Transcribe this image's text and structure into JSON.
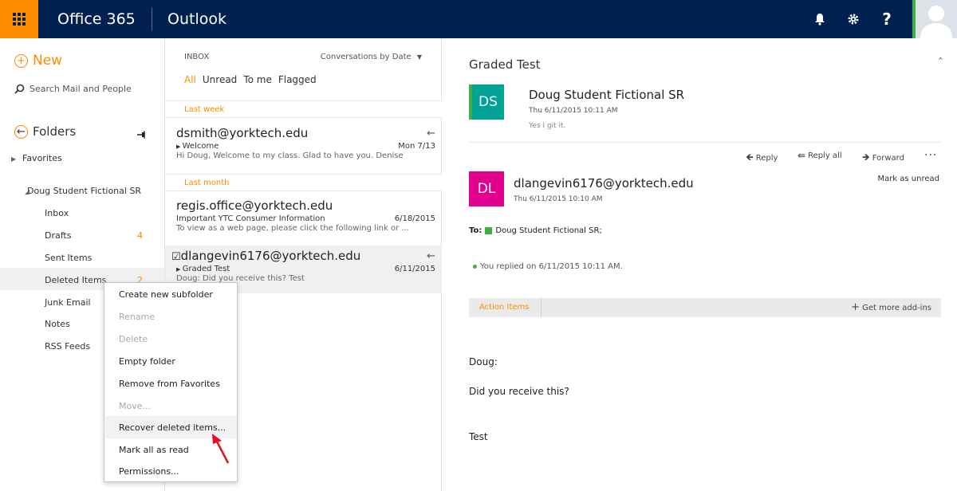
{
  "header": {
    "brand": "Office 365",
    "app": "Outlook",
    "help_label": "?"
  },
  "leftnav": {
    "new_label": "New",
    "search_placeholder": "Search Mail and People",
    "folders_label": "Folders",
    "favorites_label": "Favorites",
    "account_label": "Doug Student Fictional SR",
    "folders": [
      {
        "label": "Inbox",
        "count": ""
      },
      {
        "label": "Drafts",
        "count": "4"
      },
      {
        "label": "Sent Items",
        "count": ""
      },
      {
        "label": "Deleted Items",
        "count": "2"
      },
      {
        "label": "Junk Email",
        "count": ""
      },
      {
        "label": "Notes",
        "count": ""
      },
      {
        "label": "RSS Feeds",
        "count": ""
      }
    ]
  },
  "messagelist": {
    "folder_label": "INBOX",
    "sort_label": "Conversations by Date",
    "filters": [
      "All",
      "Unread",
      "To me",
      "Flagged"
    ],
    "groups": [
      "Last week",
      "Last month"
    ],
    "messages": [
      {
        "from": "dsmith@yorktech.edu",
        "subject": "Welcome",
        "preview": "Hi Doug,  Welcome to my class. Glad to have you.  Denise",
        "date": "Mon 7/13"
      },
      {
        "from": "regis.office@yorktech.edu",
        "subject": "Important YTC Consumer Information",
        "preview": "To view as a web page, please click the following link or ...",
        "date": "6/18/2015"
      },
      {
        "from": "dlangevin6176@yorktech.edu",
        "subject": "Graded Test",
        "preview": "Doug:  Did you receive this?  Test",
        "date": "6/11/2015"
      }
    ]
  },
  "reading": {
    "title": "Graded Test",
    "first": {
      "initials": "DS",
      "sender": "Doug Student Fictional SR",
      "date": "Thu 6/11/2015 10:11 AM",
      "preview": "Yes I git it."
    },
    "actions": {
      "reply": "Reply",
      "reply_all": "Reply all",
      "forward": "Forward",
      "more": "..."
    },
    "second": {
      "initials": "DL",
      "sender": "dlangevin6176@yorktech.edu",
      "date": "Thu 6/11/2015 10:10 AM"
    },
    "mark_unread": "Mark as unread",
    "to_label": "To:",
    "to_name": "Doug Student Fictional SR;",
    "replied_note": "You replied on 6/11/2015 10:11 AM.",
    "addins_tab": "Action Items",
    "addins_more": "Get more add-ins",
    "body": [
      "Doug:",
      "Did you receive this?",
      "Test"
    ]
  },
  "context_menu": {
    "items": [
      {
        "label": "Create new subfolder",
        "enabled": true
      },
      {
        "label": "Rename",
        "enabled": false
      },
      {
        "label": "Delete",
        "enabled": false
      },
      {
        "label": "Empty folder",
        "enabled": true
      },
      {
        "label": "Remove from Favorites",
        "enabled": true
      },
      {
        "label": "Move...",
        "enabled": false
      },
      {
        "label": "Recover deleted items...",
        "enabled": true
      },
      {
        "label": "Mark all as read",
        "enabled": true
      },
      {
        "label": "Permissions...",
        "enabled": true
      }
    ]
  },
  "colors": {
    "topbar": "#002050",
    "accent": "#ff8c00",
    "green": "#3cb043",
    "teal": "#00a396",
    "magenta": "#e3008c"
  }
}
